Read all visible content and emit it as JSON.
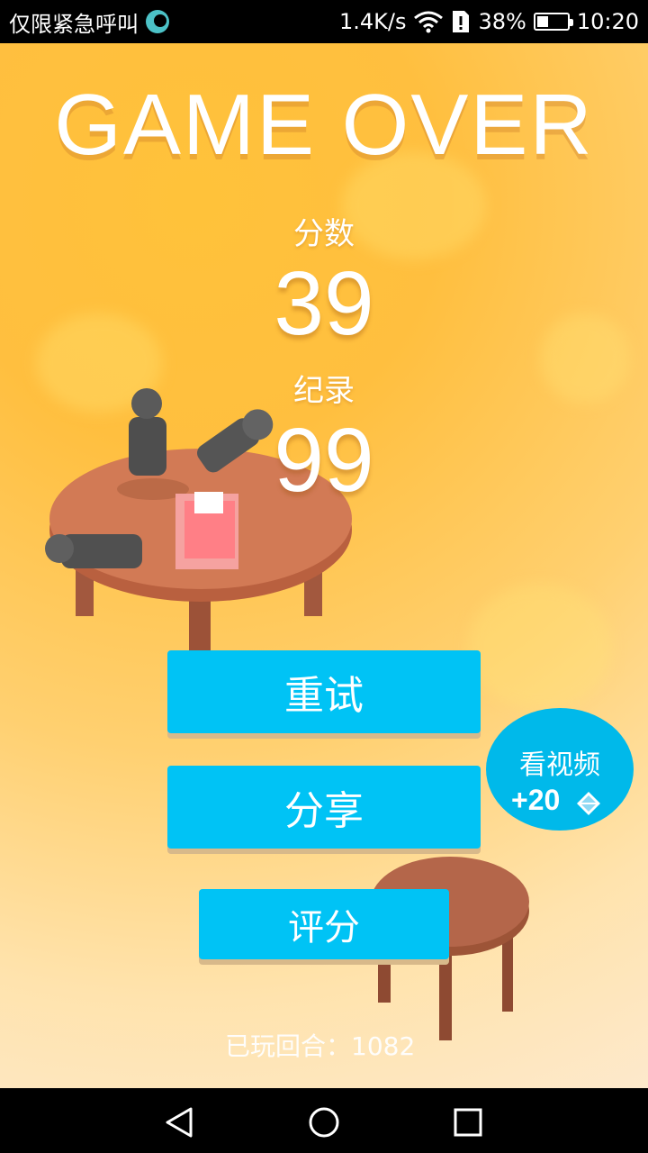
{
  "status_bar": {
    "carrier_text": "仅限紧急呼叫",
    "net_speed": "1.4K/s",
    "battery_percent": "38%",
    "time": "10:20",
    "battery_level": 0.38,
    "icons": [
      "moon-icon",
      "wifi-icon",
      "sim-alert-icon",
      "battery-icon"
    ]
  },
  "game": {
    "title": "GAME OVER",
    "score_label": "分数",
    "score_value": "39",
    "record_label": "纪录",
    "record_value": "99",
    "buttons": {
      "retry": "重试",
      "share": "分享",
      "rate": "评分"
    },
    "video_reward": {
      "label": "看视频",
      "reward": "+20",
      "icon": "diamond-icon"
    },
    "rounds_played": "已玩回合：1082",
    "colors": {
      "button": "#00c3f5",
      "video_button": "#00b9ea",
      "table": "#d27a55",
      "background_top": "#ffbf3f",
      "background_bottom": "#fde9cc"
    }
  },
  "navbar": {
    "icons": [
      "back-icon",
      "home-icon",
      "recents-icon"
    ]
  }
}
